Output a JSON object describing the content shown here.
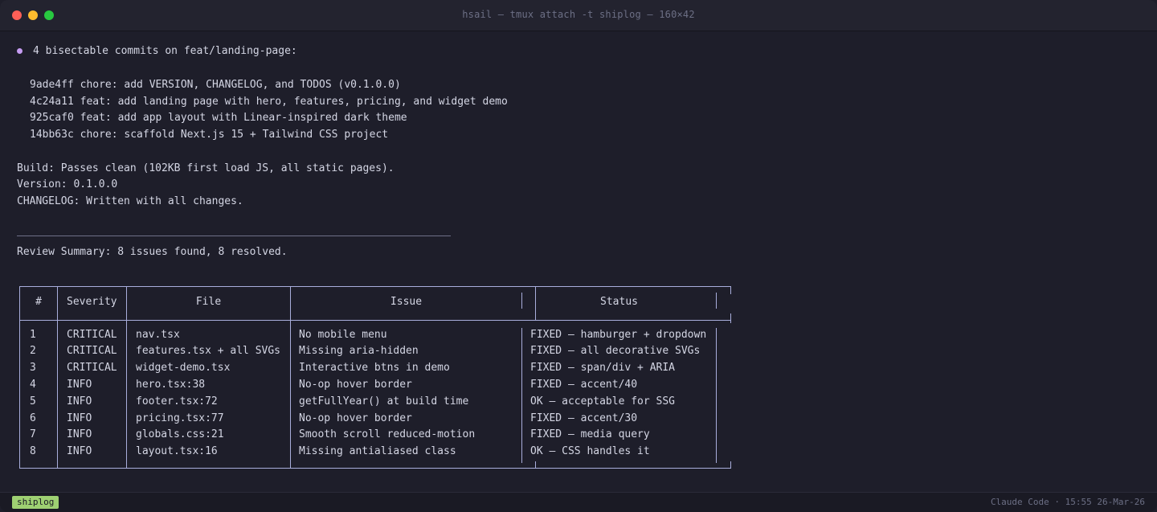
{
  "window": {
    "title": "hsail — tmux attach -t shiplog — 160×42"
  },
  "terminal": {
    "heading": "4 bisectable commits on feat/landing-page:",
    "commits": [
      "9ade4ff chore: add VERSION, CHANGELOG, and TODOS (v0.1.0.0)",
      "4c24a11 feat: add landing page with hero, features, pricing, and widget demo",
      "925caf0 feat: add app layout with Linear-inspired dark theme",
      "14bb63c chore: scaffold Next.js 15 + Tailwind CSS project"
    ],
    "build": "Build: Passes clean (102KB first load JS, all static pages).",
    "version": "Version: 0.1.0.0",
    "changelog": "CHANGELOG: Written with all changes.",
    "review_summary": "Review Summary: 8 issues found, 8 resolved."
  },
  "table": {
    "headers": [
      "#",
      "Severity",
      "File",
      "Issue",
      "Status"
    ],
    "rows": [
      [
        "1",
        "CRITICAL",
        "nav.tsx",
        "No mobile menu",
        "FIXED — hamburger + dropdown"
      ],
      [
        "2",
        "CRITICAL",
        "features.tsx + all SVGs",
        "Missing aria-hidden",
        "FIXED — all decorative SVGs"
      ],
      [
        "3",
        "CRITICAL",
        "widget-demo.tsx",
        "Interactive btns in demo",
        "FIXED — span/div + ARIA"
      ],
      [
        "4",
        "INFO",
        "hero.tsx:38",
        "No-op hover border",
        "FIXED — accent/40"
      ],
      [
        "5",
        "INFO",
        "footer.tsx:72",
        "getFullYear() at build time",
        "OK — acceptable for SSG"
      ],
      [
        "6",
        "INFO",
        "pricing.tsx:77",
        "No-op hover border",
        "FIXED — accent/30"
      ],
      [
        "7",
        "INFO",
        "globals.css:21",
        "Smooth scroll reduced-motion",
        "FIXED — media query"
      ],
      [
        "8",
        "INFO",
        "layout.tsx:16",
        "Missing antialiased class",
        "OK — CSS handles it"
      ]
    ]
  },
  "statusbar": {
    "session": "shiplog",
    "right": "Claude Code · 15:55 26-Mar-26"
  },
  "colors": {
    "background": "#1e1e2a",
    "bullet": "#c59cf2",
    "session_badge": "#9ed072",
    "table_border": "#a9aedc"
  }
}
